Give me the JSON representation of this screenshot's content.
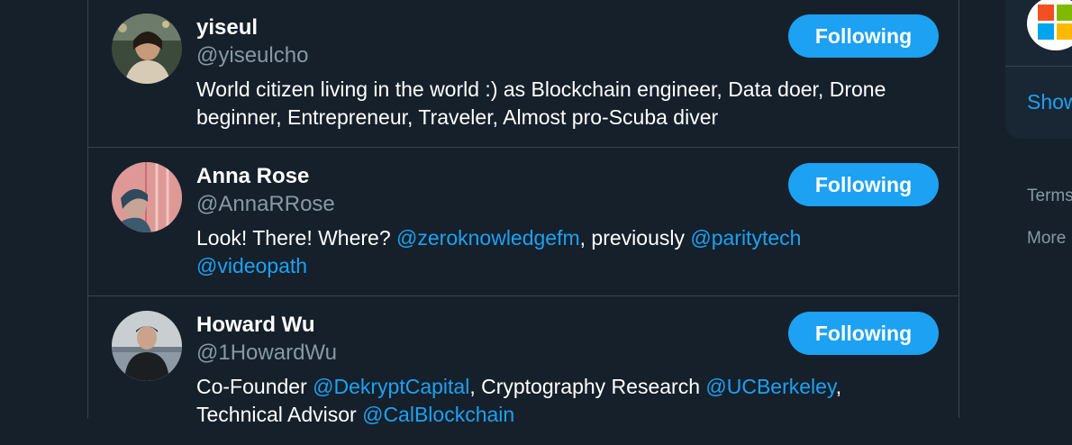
{
  "users": [
    {
      "name": "yiseul",
      "handle": "@yiseulcho",
      "button": "Following",
      "bio": {
        "parts": [
          {
            "text": "World citizen living in the world :) as Blockchain engineer, Data doer, Drone beginner, Entrepreneur, Traveler, Almost pro-Scuba diver"
          }
        ]
      }
    },
    {
      "name": "Anna Rose",
      "handle": "@AnnaRRose",
      "button": "Following",
      "bio": {
        "parts": [
          {
            "text": "Look! There! Where? "
          },
          {
            "text": "@zeroknowledgefm"
          },
          {
            "text": ", previously "
          },
          {
            "text": "@paritytech"
          },
          {
            "text": " "
          },
          {
            "text": "@videopath"
          }
        ]
      }
    },
    {
      "name": "Howard Wu",
      "handle": "@1HowardWu",
      "button": "Following",
      "bio": {
        "parts": [
          {
            "text": "Co-Founder "
          },
          {
            "text": "@DekryptCapital"
          },
          {
            "text": ", Cryptography Research "
          },
          {
            "text": "@UCBerkeley"
          },
          {
            "text": ","
          },
          {
            "text": "Technical Advisor "
          },
          {
            "text": "@CalBlockchain"
          }
        ]
      }
    }
  ],
  "sidebar": {
    "show_more": "Show",
    "footer_terms": "Terms",
    "footer_more": "More"
  },
  "colors": {
    "background": "#15202b",
    "accent": "#1da1f2",
    "secondary_text": "#8899a6",
    "border": "#38444d"
  }
}
